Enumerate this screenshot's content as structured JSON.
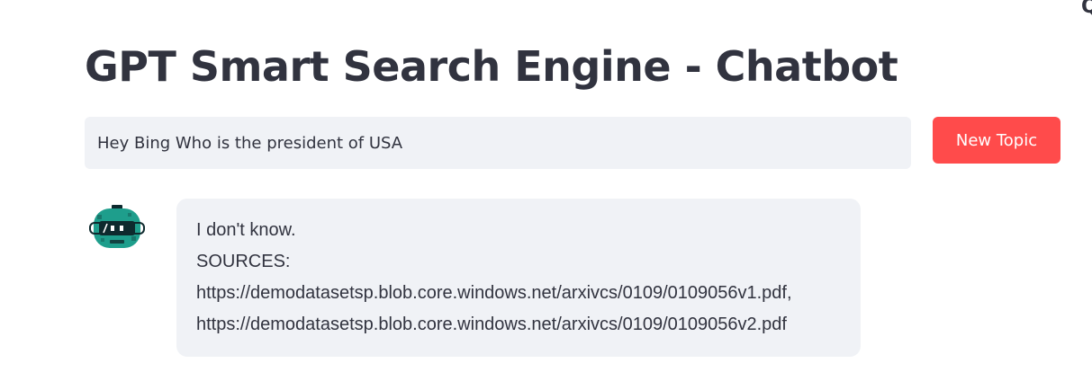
{
  "app": {
    "title": "GPT Smart Search Engine - Chatbot"
  },
  "corner": {
    "glyph": "Q",
    "icon": "search-icon"
  },
  "query": {
    "value": "Hey Bing Who is the president of USA",
    "placeholder": ""
  },
  "actions": {
    "new_topic_label": "New Topic"
  },
  "chat": {
    "avatar_icon": "robot-avatar-icon",
    "message": {
      "lines": [
        "I don't know.",
        "SOURCES:",
        "https://demodatasetsp.blob.core.windows.net/arxivcs/0109/0109056v1.pdf,",
        "https://demodatasetsp.blob.core.windows.net/arxivcs/0109/0109056v2.pdf"
      ]
    }
  },
  "colors": {
    "accent": "#ff4b4b",
    "text": "#31333f",
    "input_bg": "#f0f2f6",
    "avatar_teal": "#1e9e8c",
    "avatar_dark": "#0e2a2e"
  }
}
